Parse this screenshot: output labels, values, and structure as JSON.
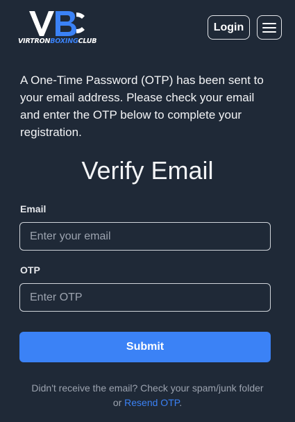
{
  "brand": {
    "logo_text_white_1": "VIRTRON",
    "logo_text_blue": "BOXING",
    "logo_text_white_2": "CLUB",
    "colors": {
      "background": "#1f2937",
      "accent": "#3b82f6",
      "text": "#f3f4f6",
      "muted": "#9ca3af"
    }
  },
  "header": {
    "login_label": "Login",
    "menu_icon": "hamburger-icon"
  },
  "main": {
    "intro_text": "A One-Time Password (OTP) has been sent to your email address. Please check your email and enter the OTP below to complete your registration.",
    "title": "Verify Email",
    "email": {
      "label": "Email",
      "placeholder": "Enter your email",
      "value": ""
    },
    "otp": {
      "label": "OTP",
      "placeholder": "Enter OTP",
      "value": ""
    },
    "submit_label": "Submit",
    "footer_text_line1": "Didn't receive the email? Check your spam/junk folder",
    "footer_text_or": "or ",
    "resend_link": "Resend OTP",
    "footer_period": "."
  }
}
